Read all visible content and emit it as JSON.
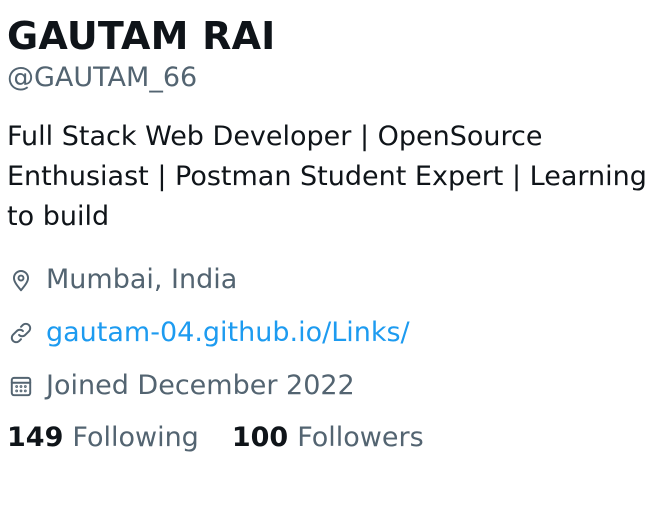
{
  "profile": {
    "name": "GAUTAM RAI",
    "handle": "@GAUTAM_66",
    "bio": "Full Stack Web Developer | OpenSource Enthusiast | Postman Student Expert | Learning to build",
    "location": "Mumbai, India",
    "website": "gautam-04.github.io/Links/",
    "joined": "Joined December 2022"
  },
  "stats": {
    "following_count": "149",
    "following_label": "Following",
    "followers_count": "100",
    "followers_label": "Followers"
  },
  "icons": {
    "location": "location-pin-icon",
    "website": "link-icon",
    "joined": "calendar-icon"
  },
  "colors": {
    "text_primary": "#0f1419",
    "text_secondary": "#536471",
    "link": "#1d9bf0"
  }
}
